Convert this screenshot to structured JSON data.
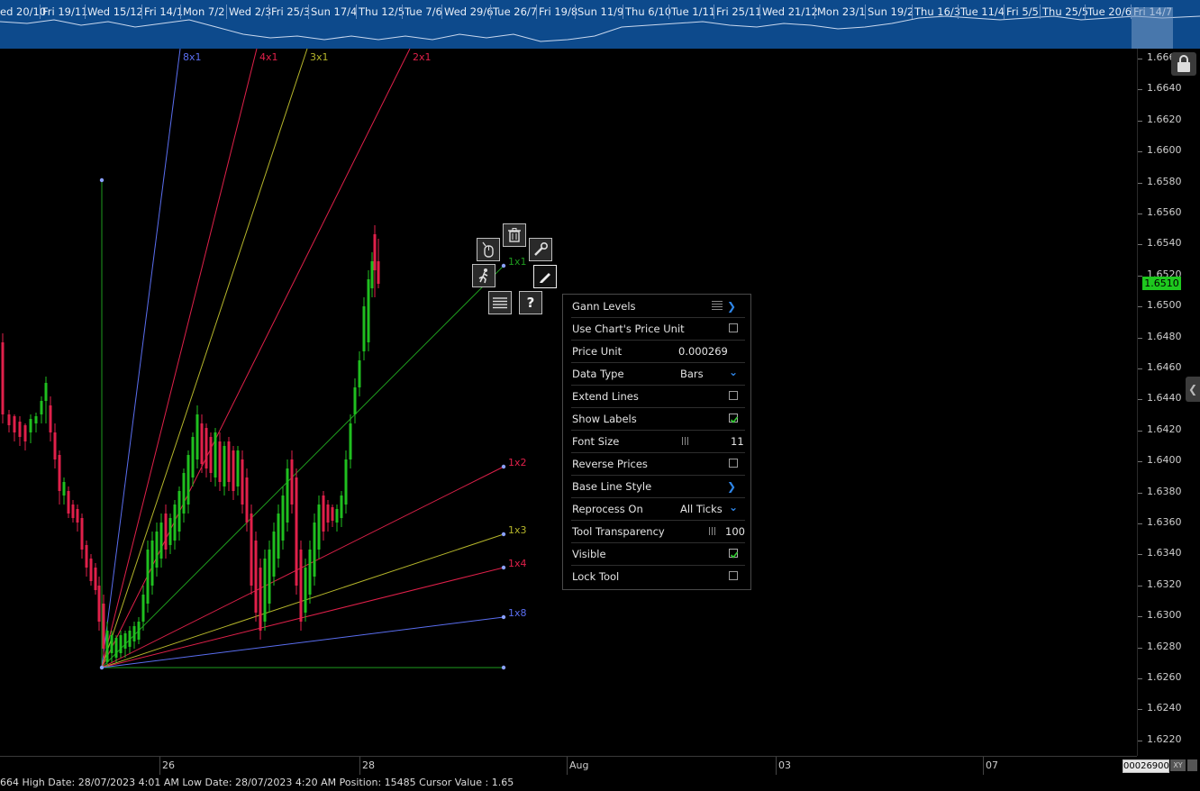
{
  "overview": {
    "dates": [
      "ed 20/10",
      "Fri 19/11",
      "Wed 15/12",
      "Fri 14/1",
      "Mon 7/2",
      "Wed 2/3",
      "Fri 25/3",
      "Sun 17/4",
      "Thu 12/5",
      "Tue 7/6",
      "Wed 29/6",
      "Tue 26/7",
      "Fri 19/8",
      "Sun 11/9",
      "Thu 6/10",
      "Tue 1/11",
      "Fri 25/11",
      "Wed 21/12",
      "Mon 23/1",
      "Sun 19/2",
      "Thu 16/3",
      "Tue 11/4",
      "Fri 5/5",
      "Thu 25/5",
      "Tue 20/6",
      "Fri 14/7"
    ]
  },
  "fan_labels": {
    "l8x1": "8x1",
    "l4x1": "4x1",
    "l3x1": "3x1",
    "l2x1": "2x1",
    "l1x1": "1x1",
    "l1x2": "1x2",
    "l1x3": "1x3",
    "l1x4": "1x4",
    "l1x8": "1x8"
  },
  "price_axis": {
    "ticks": [
      "1.666",
      "1.6640",
      "1.6620",
      "1.6600",
      "1.6580",
      "1.6560",
      "1.6540",
      "1.6520",
      "1.6500",
      "1.6480",
      "1.6460",
      "1.6440",
      "1.6420",
      "1.6400",
      "1.6380",
      "1.6360",
      "1.6340",
      "1.6320",
      "1.6300",
      "1.6280",
      "1.6260",
      "1.6240",
      "1.6220"
    ],
    "current_price": "1.6510"
  },
  "time_axis": {
    "t26": "26",
    "t28": "28",
    "taug": "Aug",
    "t03": "03",
    "t07": "07",
    "price_unit_value": "00026900",
    "xy_label": "XY"
  },
  "status_bar": {
    "text": "664 High Date: 28/07/2023 4:01 AM Low Date: 28/07/2023 4:20 AM Position: 15485 Cursor Value : 1.65"
  },
  "toolbar": {
    "icons": [
      "delete-icon",
      "mouse-icon",
      "wrench-icon",
      "running-man-icon",
      "pencil-icon",
      "lines-icon",
      "help-icon"
    ],
    "help_label": "?"
  },
  "properties": {
    "gann_levels": "Gann Levels",
    "use_chart_price_unit": "Use Chart's Price Unit",
    "price_unit_label": "Price Unit",
    "price_unit_value": "0.000269",
    "data_type_label": "Data Type",
    "data_type_value": "Bars",
    "extend_lines": "Extend Lines",
    "show_labels": "Show Labels",
    "font_size_label": "Font Size",
    "font_size_value": "11",
    "reverse_prices": "Reverse Prices",
    "base_line_style": "Base Line Style",
    "reprocess_on_label": "Reprocess On",
    "reprocess_on_value": "All Ticks",
    "tool_transparency_label": "Tool Transparency",
    "tool_transparency_value": "100",
    "visible": "Visible",
    "lock_tool": "Lock Tool",
    "checked": {
      "use_chart_price_unit": false,
      "extend_lines": false,
      "show_labels": true,
      "reverse_prices": false,
      "visible": true,
      "lock_tool": false
    }
  },
  "colors": {
    "overview_bg": "#0d4a8c",
    "bull_candle": "#1fbf1f",
    "bear_candle": "#e0204a",
    "fan_1x1": "#1e9b1e",
    "fan_2x": "#e0204a",
    "fan_3x": "#b5b52a",
    "fan_8x": "#5a6ef0",
    "current_price_bg": "#1ec81e",
    "accent": "#2f86e8"
  }
}
